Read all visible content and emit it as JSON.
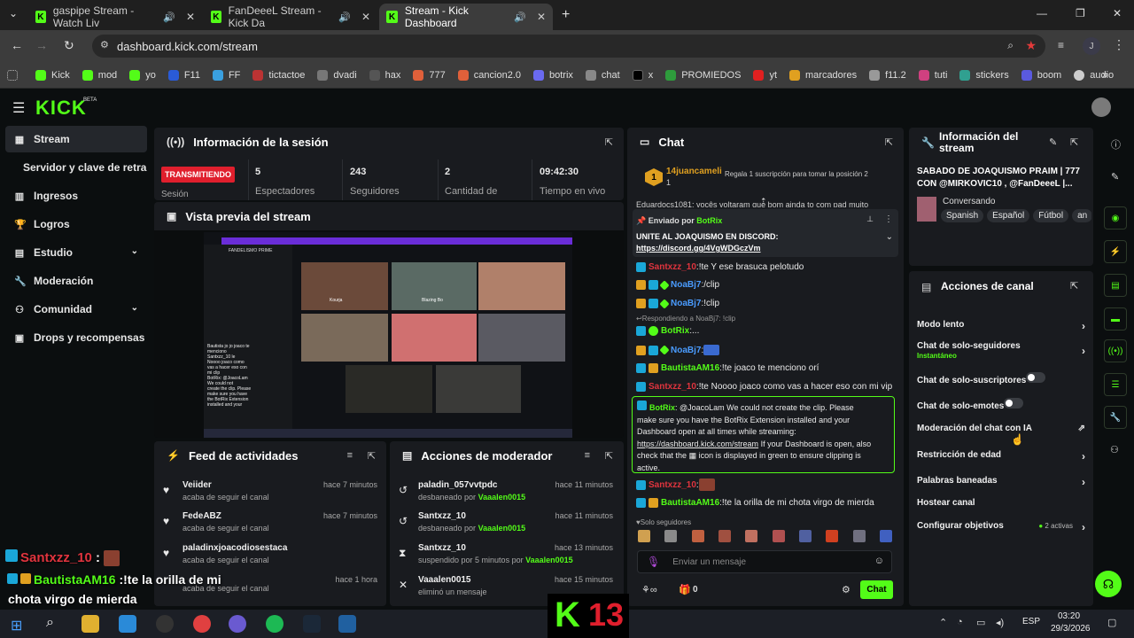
{
  "browser": {
    "tabs": [
      {
        "label": "gaspipe Stream - Watch Liv"
      },
      {
        "label": "FanDeeeL Stream - Kick Da"
      },
      {
        "label": "Stream - Kick Dashboard"
      }
    ],
    "url": "dashboard.kick.com/stream",
    "profile_initial": "J",
    "bookmarks": [
      "Kick",
      "mod",
      "yo",
      "F11",
      "FF",
      "tictactoe",
      "dvadi",
      "hax",
      "777",
      "cancion2.0",
      "botrix",
      "chat",
      "x",
      "PROMIEDOS",
      "yt",
      "marcadores",
      "f11.2",
      "tuti",
      "stickers",
      "boom",
      "audio"
    ]
  },
  "brand": {
    "logo": "KICK",
    "beta": "BETA"
  },
  "nav": {
    "items": [
      "Stream",
      "Servidor y clave de retransn",
      "Ingresos",
      "Logros",
      "Estudio",
      "Moderación",
      "Comunidad",
      "Drops y recompensas"
    ]
  },
  "session": {
    "title": "Información de la sesión",
    "badge": "TRANSMITIENDO",
    "badge_sub": "Sesión",
    "stats": [
      {
        "value": "5",
        "label": "Espectadores"
      },
      {
        "value": "243",
        "label": "Seguidores"
      },
      {
        "value": "2",
        "label": "Cantidad de"
      },
      {
        "value": "09:42:30",
        "label": "Tiempo en vivo"
      }
    ]
  },
  "preview": {
    "title": "Vista previa del stream",
    "banner": "FANDELISMO PRIME",
    "overlay_lines": [
      "Bautista jo jo joaco te",
      "menciono",
      "Santxzz_10 le",
      "Noooo joaco como",
      "vas a hacer eso con",
      "mi clip",
      "BotRix: @JoacoLam",
      "We could not",
      "create the clip. Please",
      "make sure you have",
      "the BotRix Extension",
      "installed and your",
      "Dashboard open at all",
      "times while",
      "streaming: ...",
      "your Dashboard is",
      "open, also check that",
      "the icon is displayed",
      "in green to ensure",
      "clipping is active."
    ],
    "tiles": [
      "Kourja",
      "Blazing Bo"
    ]
  },
  "feed": {
    "title": "Feed de actividades",
    "items": [
      {
        "name": "Veiider",
        "sub": "acaba de seguir el canal",
        "time": "hace 7 minutos"
      },
      {
        "name": "FedeABZ",
        "sub": "acaba de seguir el canal",
        "time": "hace 7 minutos"
      },
      {
        "name": "paladinxjoacodiosestaca",
        "sub": "acaba de seguir el canal",
        "time": "hace 7 minutos"
      },
      {
        "name": "",
        "sub": "acaba de seguir el canal",
        "time": "hace 1 hora"
      }
    ]
  },
  "modactions": {
    "title": "Acciones de moderador",
    "items": [
      {
        "name": "paladin_057vvtpdc",
        "sub": "desbaneado por",
        "by": "Vaaalen0015",
        "time": "hace 11 minutos"
      },
      {
        "name": "Santxzz_10",
        "sub": "desbaneado por",
        "by": "Vaaalen0015",
        "time": "hace 11 minutos"
      },
      {
        "name": "Santxzz_10",
        "sub": "suspendido por 5 minutos por",
        "by": "Vaaalen0015",
        "time": "hace 13 minutos"
      },
      {
        "name": "Vaaalen0015",
        "sub": "eliminó un mensaje",
        "by": "",
        "time": "hace 15 minutos"
      }
    ]
  },
  "chat": {
    "title": "Chat",
    "top_gifter": {
      "name": "14juancameli",
      "count": "1",
      "rank": "1",
      "prompt": "Regala 1 suscripción para tomar la posición 2"
    },
    "cut_line": "Eduardocs1081: vocês voltaram que bom ainda to com pad muito",
    "pinned": {
      "label": "Enviado por",
      "user": "BotRix",
      "text": "UNITE AL JOAQUISMO EN DISCORD:",
      "link": "https://discord.gg/4VgWDGczVm"
    },
    "messages": [
      {
        "user": "Santxzz_10",
        "text": "!te Y ese brasuca pelotudo",
        "color": "#e0343e"
      },
      {
        "user": "NoaBj7",
        "text": "/clip",
        "color": "#4a9cff"
      },
      {
        "user": "NoaBj7",
        "text": "!clip",
        "color": "#4a9cff"
      },
      {
        "user": "BotRix",
        "text": "...",
        "color": "#53fc18",
        "reply": "Respondiendo a NoaBj7: !clip"
      },
      {
        "user": "NoaBj7",
        "text": "",
        "color": "#4a9cff"
      },
      {
        "user": "BautistaAM16",
        "text": "!te joaco te menciono orí",
        "color": "#53fc18"
      },
      {
        "user": "Santxzz_10",
        "text": "!te Noooo joaco como vas a hacer eso con mi vip",
        "color": "#e0343e"
      }
    ],
    "botmsg": {
      "user": "BotRix",
      "lines": [
        "@JoacoLam We could not create the clip. Please",
        "make sure you have the BotRix Extension installed and your",
        "Dashboard open at all times while streaming:"
      ],
      "link": "https://dashboard.kick.com/stream",
      "lines2": [
        "If your Dashboard is open, also",
        "check that the",
        "icon is displayed in green to ensure clipping is",
        "active."
      ]
    },
    "after": [
      {
        "user": "Santxzz_10",
        "text": "",
        "color": "#e0343e"
      },
      {
        "user": "BautistaAM16",
        "text": "!te la orilla de mi chota virgo de mierda",
        "color": "#53fc18"
      }
    ],
    "followers_only": "Solo seguidores",
    "placeholder": "Enviar un mensaje",
    "points": "0",
    "send": "Chat"
  },
  "streaminfo": {
    "title": "Información del stream",
    "stream_title": "SABADO DE JOAQUISMO PRAIM | 777 CON @MIRKOVIC10 , @FanDeeeL |...",
    "category": "Conversando",
    "tags": [
      "Spanish",
      "Español",
      "Fútbol",
      "an"
    ]
  },
  "channel": {
    "title": "Acciones de canal",
    "rows": [
      {
        "label": "Modo lento",
        "sub": "",
        "kind": "chev"
      },
      {
        "label": "Chat de solo-seguidores",
        "sub": "Instantáneo",
        "kind": "chev"
      },
      {
        "label": "Chat de solo-suscriptores",
        "sub": "",
        "kind": "toggle"
      },
      {
        "label": "Chat de solo-emotes",
        "sub": "",
        "kind": "toggle"
      },
      {
        "label": "Moderación del chat con IA",
        "sub": "",
        "kind": "ext"
      },
      {
        "label": "Restricción de edad",
        "sub": "",
        "kind": "chev"
      },
      {
        "label": "Palabras baneadas",
        "sub": "",
        "kind": "chev"
      },
      {
        "label": "Hostear canal",
        "sub": "",
        "kind": "none"
      },
      {
        "label": "Configurar objetivos",
        "sub": "",
        "kind": "chev",
        "extra": "2 activas"
      }
    ]
  },
  "overlay": {
    "line1_user": "Santxzz_10",
    "line1_sep": ":",
    "line2_user": "BautistaAM16",
    "line2_text": ":!te la orilla de mi",
    "line3": "chota virgo de mierda",
    "logo_k": "K",
    "logo_num": "13"
  },
  "taskbar": {
    "lang": "ESP",
    "time": "03:20",
    "date": "29/3/2026"
  }
}
